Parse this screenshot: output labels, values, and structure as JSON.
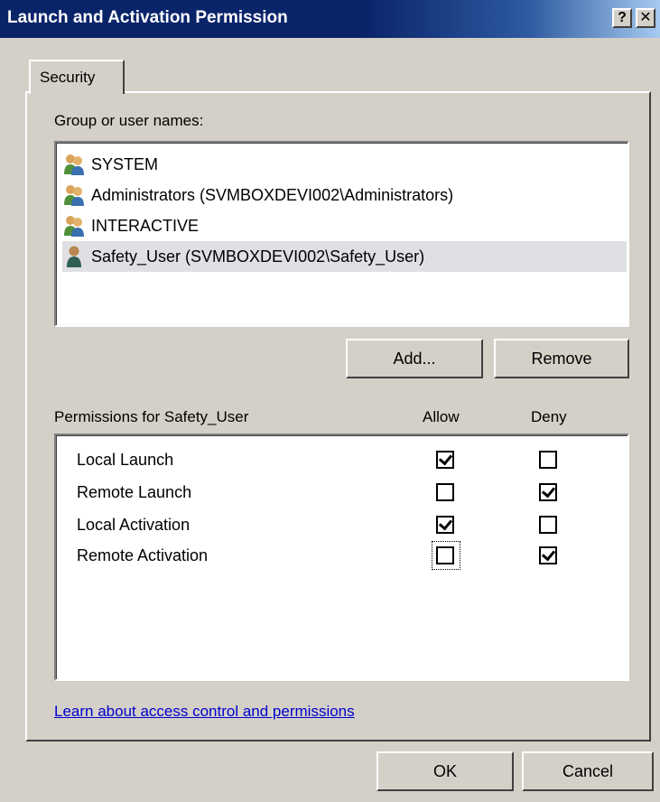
{
  "window": {
    "title": "Launch and Activation Permission",
    "help_button": "?",
    "close_button": "✕"
  },
  "tabs": [
    {
      "label": "Security",
      "active": true
    }
  ],
  "users_section": {
    "label": "Group or user names:",
    "items": [
      {
        "name": "SYSTEM",
        "icon": "group-icon",
        "selected": false
      },
      {
        "name": "Administrators (SVMBOXDEVI002\\Administrators)",
        "icon": "group-icon",
        "selected": false
      },
      {
        "name": "INTERACTIVE",
        "icon": "group-icon",
        "selected": false
      },
      {
        "name": "Safety_User (SVMBOXDEVI002\\Safety_User)",
        "icon": "user-icon",
        "selected": true
      }
    ],
    "add_label": "Add...",
    "remove_label": "Remove"
  },
  "permissions_section": {
    "label": "Permissions for Safety_User",
    "allow_header": "Allow",
    "deny_header": "Deny",
    "rows": [
      {
        "name": "Local Launch",
        "allow": true,
        "deny": false
      },
      {
        "name": "Remote Launch",
        "allow": false,
        "deny": true
      },
      {
        "name": "Local Activation",
        "allow": true,
        "deny": false
      },
      {
        "name": "Remote Activation",
        "allow": false,
        "deny": true,
        "focused": "allow"
      }
    ]
  },
  "link_text": "Learn about access control and permissions",
  "footer": {
    "ok_label": "OK",
    "cancel_label": "Cancel"
  },
  "colors": {
    "titlebar": "#0a246a",
    "dialog_face": "#d4d0c8",
    "link": "#0000cc",
    "selected_row": "#e0dfe3"
  }
}
